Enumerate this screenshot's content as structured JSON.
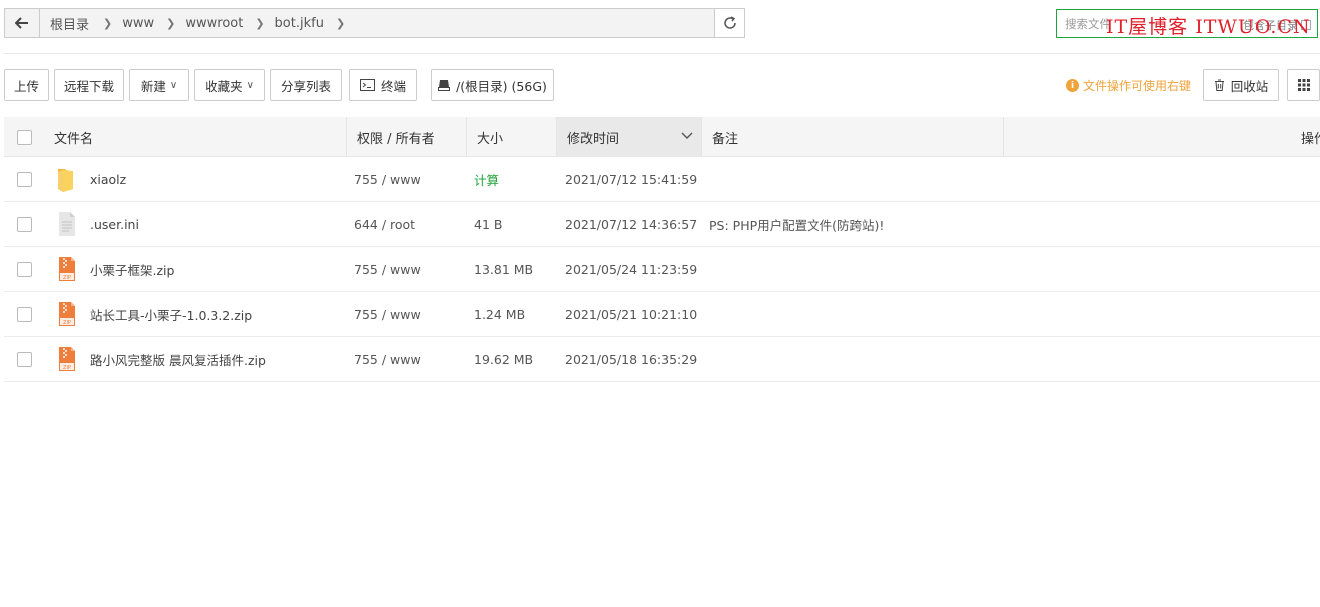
{
  "address_bar": {
    "crumbs": [
      "根目录",
      "www",
      "wwwroot",
      "bot.jkfu"
    ]
  },
  "search": {
    "placeholder": "搜索文件",
    "subdir_label": "包含子目录"
  },
  "watermark": "IT屋博客 ITWUO.CN",
  "toolbar": {
    "upload": "上传",
    "remote_download": "远程下载",
    "new": "新建",
    "favorites": "收藏夹",
    "share_list": "分享列表",
    "terminal": "终端",
    "disk": "/(根目录) (56G)",
    "tip": "文件操作可使用右键",
    "recycle_bin": "回收站"
  },
  "table": {
    "headers": {
      "name": "文件名",
      "perm": "权限 / 所有者",
      "size": "大小",
      "mtime": "修改时间",
      "remark": "备注",
      "actions": "操作"
    },
    "rows": [
      {
        "name": "xiaolz",
        "type": "folder-icon",
        "perm": "755 / www",
        "size": "计算",
        "mtime": "2021/07/12 15:41:59",
        "remark": ""
      },
      {
        "name": ".user.ini",
        "type": "file-icon",
        "perm": "644 / root",
        "size": "41 B",
        "mtime": "2021/07/12 14:36:57",
        "remark": "PS: PHP用户配置文件(防跨站)!"
      },
      {
        "name": "小栗子框架.zip",
        "type": "zip-icon",
        "perm": "755 / www",
        "size": "13.81 MB",
        "mtime": "2021/05/24 11:23:59",
        "remark": ""
      },
      {
        "name": "站长工具-小栗子-1.0.3.2.zip",
        "type": "zip-icon",
        "perm": "755 / www",
        "size": "1.24 MB",
        "mtime": "2021/05/21 10:21:10",
        "remark": ""
      },
      {
        "name": "路小风完整版 晨风复活插件.zip",
        "type": "zip-icon",
        "perm": "755 / www",
        "size": "19.62 MB",
        "mtime": "2021/05/18 16:35:29",
        "remark": ""
      }
    ]
  },
  "colors": {
    "accent_green": "#20a53a",
    "tip_orange": "#f0a33a",
    "folder_yellow": "#f7c948",
    "zip_orange": "#ef7d3c",
    "watermark_red": "#e0202a"
  }
}
